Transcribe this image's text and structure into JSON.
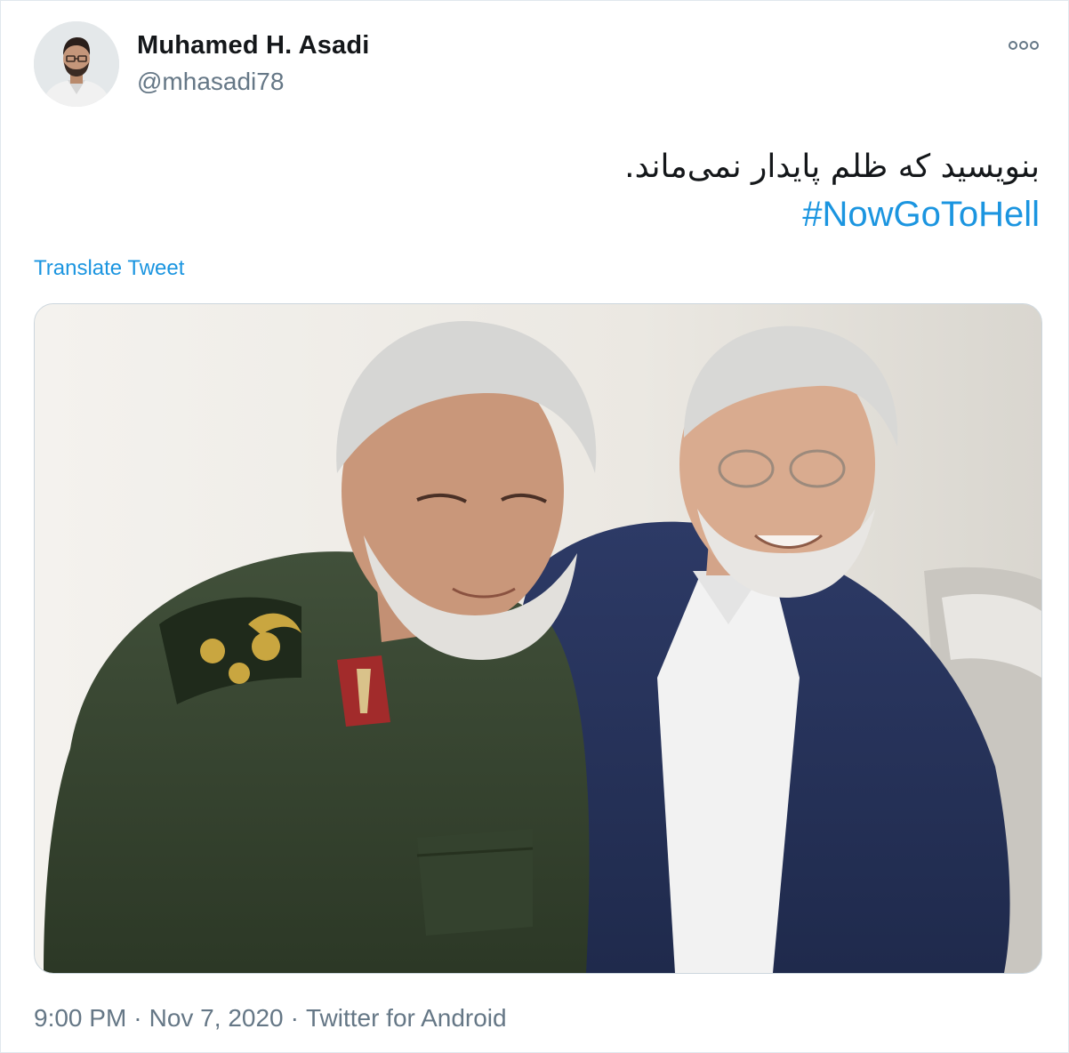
{
  "author": {
    "display_name": "Muhamed H. Asadi",
    "handle": "@mhasadi78",
    "avatar_icon": "avatar-photo"
  },
  "tweet": {
    "text": "بنویسید که ظلم پایدار نمی‌ماند.",
    "hashtag": "#NowGoToHell",
    "translate_label": "Translate Tweet"
  },
  "media": {
    "image_icon": "photo"
  },
  "footer": {
    "time": "9:00 PM",
    "date": "Nov 7, 2020",
    "source": "Twitter for Android",
    "separator": "·"
  },
  "colors": {
    "link": "#1b95e0",
    "secondary_text": "#657786",
    "primary_text": "#14171a",
    "border": "#ccd6dd"
  },
  "icons": {
    "more": "more-icon"
  }
}
